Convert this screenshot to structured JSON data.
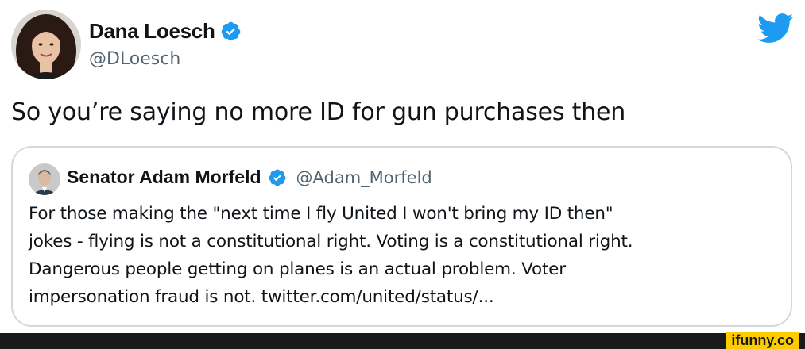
{
  "tweet": {
    "author_name": "Dana Loesch",
    "author_handle": "@DLoesch",
    "text": "So you’re saying no more ID for gun purchases then"
  },
  "quoted_tweet": {
    "author_name": "Senator Adam Morfeld",
    "author_handle": "@Adam_Morfeld",
    "lines": [
      "For those making the \"next time I fly United I won't bring my ID then\"",
      "jokes - flying is not a constitutional right. Voting is a constitutional right.",
      "Dangerous people getting on planes is an actual problem. Voter",
      "impersonation fraud is not. twitter.com/united/status/..."
    ]
  },
  "icons": {
    "brand": "twitter-bird-icon",
    "verified": "verified-badge-icon"
  },
  "watermark": {
    "text": "ifunny.co"
  },
  "colors": {
    "twitter_blue": "#1d9bf0",
    "handle_gray": "#536471",
    "border": "#cfd9de",
    "watermark_yellow": "#ffcc00"
  }
}
